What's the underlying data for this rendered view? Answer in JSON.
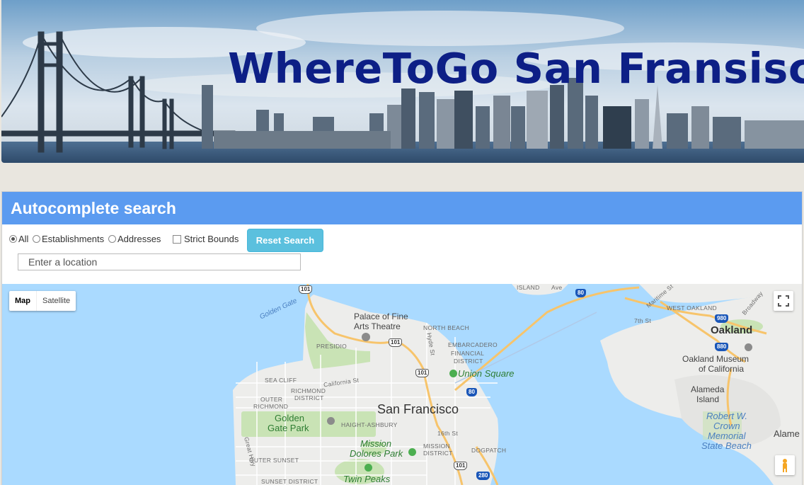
{
  "banner": {
    "title": "WhereToGo San Fransisco"
  },
  "panel": {
    "title": "Autocomplete search",
    "filters": [
      {
        "label": "All",
        "type": "radio",
        "checked": true
      },
      {
        "label": "Establishments",
        "type": "radio",
        "checked": false
      },
      {
        "label": "Addresses",
        "type": "radio",
        "checked": false
      },
      {
        "label": "Strict Bounds",
        "type": "checkbox",
        "checked": false
      }
    ],
    "reset_label": "Reset Search",
    "location_placeholder": "Enter a location"
  },
  "map": {
    "map_type_map": "Map",
    "map_type_satellite": "Satellite",
    "labels": {
      "golden_gate": "Golden Gate",
      "palace": "Palace of Fine",
      "palace2": "Arts Theatre",
      "north_beach": "NORTH BEACH",
      "presidio": "PRESIDIO",
      "embarcadero": "EMBARCADERO",
      "financial": "FINANCIAL",
      "district": "DISTRICT",
      "union_square": "Union Square",
      "sea_cliff": "SEA CLIFF",
      "richmond": "RICHMOND",
      "richmond_district": "DISTRICT",
      "outer": "OUTER",
      "outer_richmond": "RICHMOND",
      "california_st": "California St",
      "san_francisco": "San Francisco",
      "golden_gate_park": "Golden",
      "golden_gate_park2": "Gate Park",
      "haight": "HAIGHT-ASHBURY",
      "sixteenth": "16th St",
      "mission_district": "MISSION",
      "mission_district2": "DISTRICT",
      "mission_dolores": "Mission",
      "mission_dolores2": "Dolores Park",
      "dogpatch": "DOGPATCH",
      "outer_sunset": "OUTER SUNSET",
      "sunset_district": "SUNSET DISTRICT",
      "twin_peaks": "Twin Peaks",
      "great_hwy": "Great Hwy",
      "hyde_st": "Hyde St",
      "island": "ISLAND",
      "avenue": "Ave",
      "maritime": "Maritime St",
      "west_oakland": "WEST OAKLAND",
      "broadway": "Broadway",
      "seventh": "7th St",
      "oakland": "Oakland",
      "oakland_museum": "Oakland Museum",
      "oakland_museum2": "of California",
      "alameda": "Alameda",
      "alameda2": "Island",
      "crown1": "Robert W.",
      "crown2": "Crown",
      "crown3": "Memorial",
      "crown4": "State Beach",
      "alameda_right": "Alame"
    },
    "shields": {
      "s101a": "101",
      "s101b": "101",
      "s101c": "101",
      "s101d": "101",
      "s80a": "80",
      "s80b": "80",
      "s980": "980",
      "s880": "880",
      "s280": "280"
    }
  }
}
